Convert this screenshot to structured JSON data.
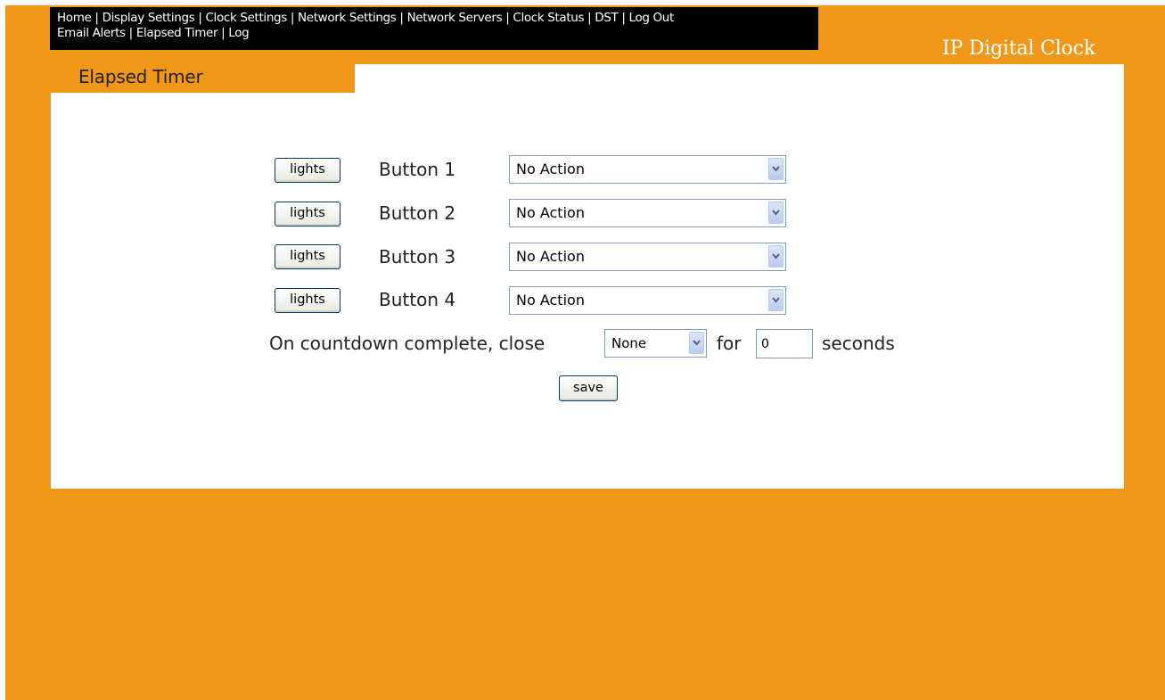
{
  "nav": {
    "row1": [
      "Home",
      "Display Settings",
      "Clock Settings",
      "Network Settings",
      "Network Servers",
      "Clock Status",
      "DST",
      "Log Out"
    ],
    "row2": [
      "Email Alerts",
      "Elapsed Timer",
      "Log"
    ],
    "separator": "|"
  },
  "brand": "IP Digital Clock",
  "page_title": "Elapsed Timer",
  "rows": [
    {
      "lights_label": "lights",
      "label": "Button 1",
      "action": "No Action"
    },
    {
      "lights_label": "lights",
      "label": "Button 2",
      "action": "No Action"
    },
    {
      "lights_label": "lights",
      "label": "Button 3",
      "action": "No Action"
    },
    {
      "lights_label": "lights",
      "label": "Button 4",
      "action": "No Action"
    }
  ],
  "countdown": {
    "prefix": "On countdown complete, close",
    "close_value": "None",
    "for_label": "for",
    "seconds_value": "0",
    "suffix": "seconds"
  },
  "save_label": "save",
  "colors": {
    "background": "#f0971a",
    "nav_background": "#000000",
    "panel": "#ffffff"
  }
}
